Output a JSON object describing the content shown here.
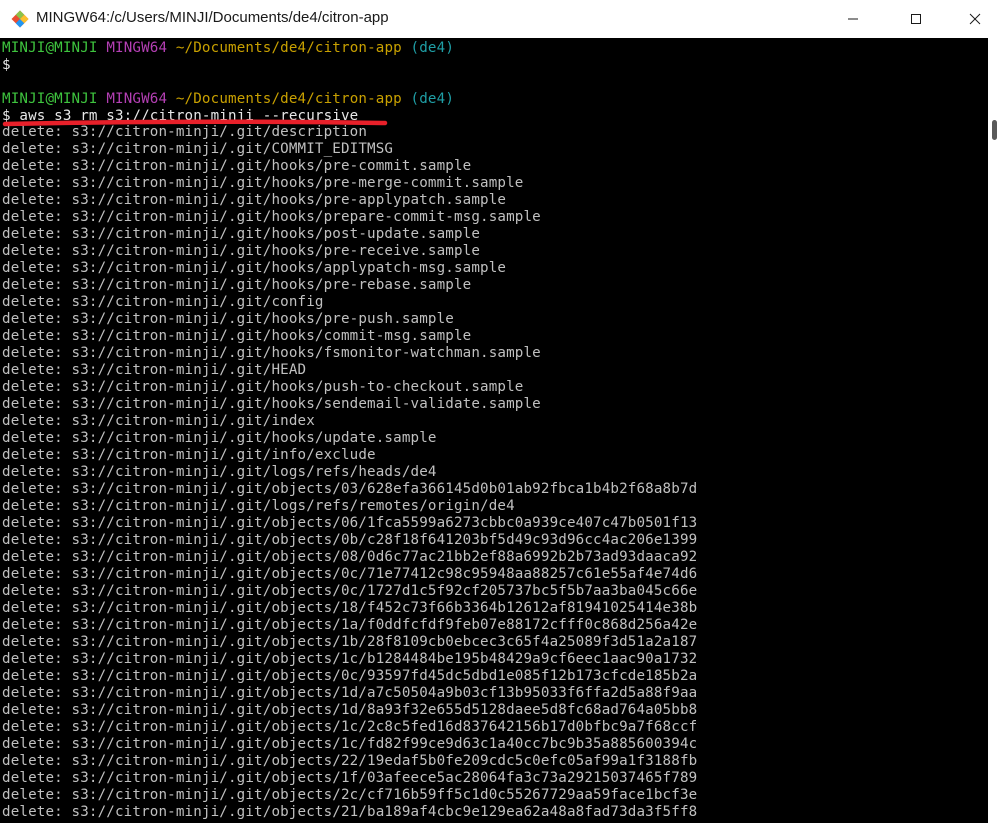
{
  "window": {
    "title": "MINGW64:/c/Users/MINJI/Documents/de4/citron-app",
    "controls": [
      "minimize-icon",
      "maximize-icon",
      "close-icon"
    ]
  },
  "colors": {
    "user": "#3ec43e",
    "system": "#b43fb4",
    "path": "#c8a000",
    "branch": "#1f9fa6",
    "highlight": "#e8202a"
  },
  "prompt1": {
    "user": "MINJI@MINJI",
    "system": "MINGW64",
    "path": "~/Documents/de4/citron-app",
    "branch": "(de4)",
    "symbol": "$"
  },
  "prompt2": {
    "user": "MINJI@MINJI",
    "system": "MINGW64",
    "path": "~/Documents/de4/citron-app",
    "branch": "(de4)",
    "command": "$ aws s3 rm s3://citron-minji --recursive"
  },
  "output": [
    "delete: s3://citron-minji/.git/description",
    "delete: s3://citron-minji/.git/COMMIT_EDITMSG",
    "delete: s3://citron-minji/.git/hooks/pre-commit.sample",
    "delete: s3://citron-minji/.git/hooks/pre-merge-commit.sample",
    "delete: s3://citron-minji/.git/hooks/pre-applypatch.sample",
    "delete: s3://citron-minji/.git/hooks/prepare-commit-msg.sample",
    "delete: s3://citron-minji/.git/hooks/post-update.sample",
    "delete: s3://citron-minji/.git/hooks/pre-receive.sample",
    "delete: s3://citron-minji/.git/hooks/applypatch-msg.sample",
    "delete: s3://citron-minji/.git/hooks/pre-rebase.sample",
    "delete: s3://citron-minji/.git/config",
    "delete: s3://citron-minji/.git/hooks/pre-push.sample",
    "delete: s3://citron-minji/.git/hooks/commit-msg.sample",
    "delete: s3://citron-minji/.git/hooks/fsmonitor-watchman.sample",
    "delete: s3://citron-minji/.git/HEAD",
    "delete: s3://citron-minji/.git/hooks/push-to-checkout.sample",
    "delete: s3://citron-minji/.git/hooks/sendemail-validate.sample",
    "delete: s3://citron-minji/.git/index",
    "delete: s3://citron-minji/.git/hooks/update.sample",
    "delete: s3://citron-minji/.git/info/exclude",
    "delete: s3://citron-minji/.git/logs/refs/heads/de4",
    "delete: s3://citron-minji/.git/objects/03/628efa366145d0b01ab92fbca1b4b2f68a8b7d",
    "delete: s3://citron-minji/.git/logs/refs/remotes/origin/de4",
    "delete: s3://citron-minji/.git/objects/06/1fca5599a6273cbbc0a939ce407c47b0501f13",
    "delete: s3://citron-minji/.git/objects/0b/c28f18f641203bf5d49c93d96cc4ac206e1399",
    "delete: s3://citron-minji/.git/objects/08/0d6c77ac21bb2ef88a6992b2b73ad93daaca92",
    "delete: s3://citron-minji/.git/objects/0c/71e77412c98c95948aa88257c61e55af4e74d6",
    "delete: s3://citron-minji/.git/objects/0c/1727d1c5f92cf205737bc5f5b7aa3ba045c66e",
    "delete: s3://citron-minji/.git/objects/18/f452c73f66b3364b12612af81941025414e38b",
    "delete: s3://citron-minji/.git/objects/1a/f0ddfcfdf9feb07e88172cfff0c868d256a42e",
    "delete: s3://citron-minji/.git/objects/1b/28f8109cb0ebcec3c65f4a25089f3d51a2a187",
    "delete: s3://citron-minji/.git/objects/1c/b1284484be195b48429a9cf6eec1aac90a1732",
    "delete: s3://citron-minji/.git/objects/0c/93597fd45dc5dbd1e085f12b173cfcde185b2a",
    "delete: s3://citron-minji/.git/objects/1d/a7c50504a9b03cf13b95033f6ffa2d5a88f9aa",
    "delete: s3://citron-minji/.git/objects/1d/8a93f32e655d5128daee5d8fc68ad764a05bb8",
    "delete: s3://citron-minji/.git/objects/1c/2c8c5fed16d837642156b17d0bfbc9a7f68ccf",
    "delete: s3://citron-minji/.git/objects/1c/fd82f99ce9d63c1a40cc7bc9b35a885600394c",
    "delete: s3://citron-minji/.git/objects/22/19edaf5b0fe209cdc5c0efc05af99a1f3188fb",
    "delete: s3://citron-minji/.git/objects/1f/03afeece5ac28064fa3c73a29215037465f789",
    "delete: s3://citron-minji/.git/objects/2c/cf716b59ff5c1d0c55267729aa59face1bcf3e",
    "delete: s3://citron-minji/.git/objects/21/ba189af4cbc9e129ea62a48a8fad73da3f5ff8"
  ]
}
